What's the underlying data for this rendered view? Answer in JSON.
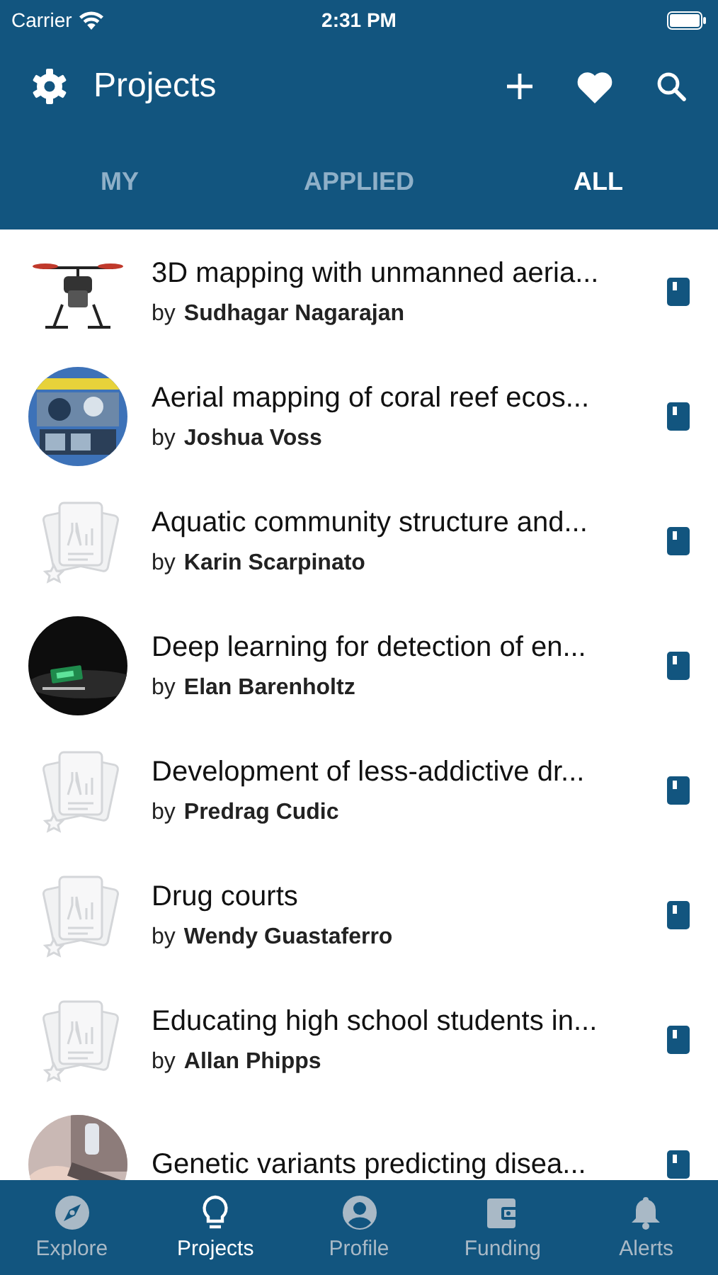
{
  "status_bar": {
    "carrier": "Carrier",
    "time": "2:31 PM"
  },
  "header": {
    "title": "Projects"
  },
  "tabs": [
    {
      "label": "MY",
      "selected": false
    },
    {
      "label": "APPLIED",
      "selected": false
    },
    {
      "label": "ALL",
      "selected": true
    }
  ],
  "projects": [
    {
      "title": "3D mapping with unmanned aeria...",
      "author_prefix": "by",
      "author": "Sudhagar Nagarajan",
      "kind": "picture"
    },
    {
      "title": "Aerial mapping of coral reef ecos...",
      "author_prefix": "by",
      "author": "Joshua Voss",
      "kind": "picture"
    },
    {
      "title": "Aquatic community structure and...",
      "author_prefix": "by",
      "author": "Karin Scarpinato",
      "kind": "placeholder"
    },
    {
      "title": "Deep learning for detection of en...",
      "author_prefix": "by",
      "author": "Elan Barenholtz",
      "kind": "picture"
    },
    {
      "title": "Development of less-addictive dr...",
      "author_prefix": "by",
      "author": "Predrag Cudic",
      "kind": "placeholder"
    },
    {
      "title": "Drug courts",
      "author_prefix": "by",
      "author": "Wendy Guastaferro",
      "kind": "placeholder"
    },
    {
      "title": "Educating high school students in...",
      "author_prefix": "by",
      "author": "Allan Phipps",
      "kind": "placeholder"
    },
    {
      "title": "Genetic variants predicting disea...",
      "kind": "picture"
    }
  ],
  "bottom_tabs": [
    {
      "label": "Explore",
      "selected": false,
      "kind": "compass"
    },
    {
      "label": "Projects",
      "selected": true,
      "kind": "bulb"
    },
    {
      "label": "Profile",
      "selected": false,
      "kind": "person"
    },
    {
      "label": "Funding",
      "selected": false,
      "kind": "wallet"
    },
    {
      "label": "Alerts",
      "selected": false,
      "kind": "bell"
    }
  ]
}
